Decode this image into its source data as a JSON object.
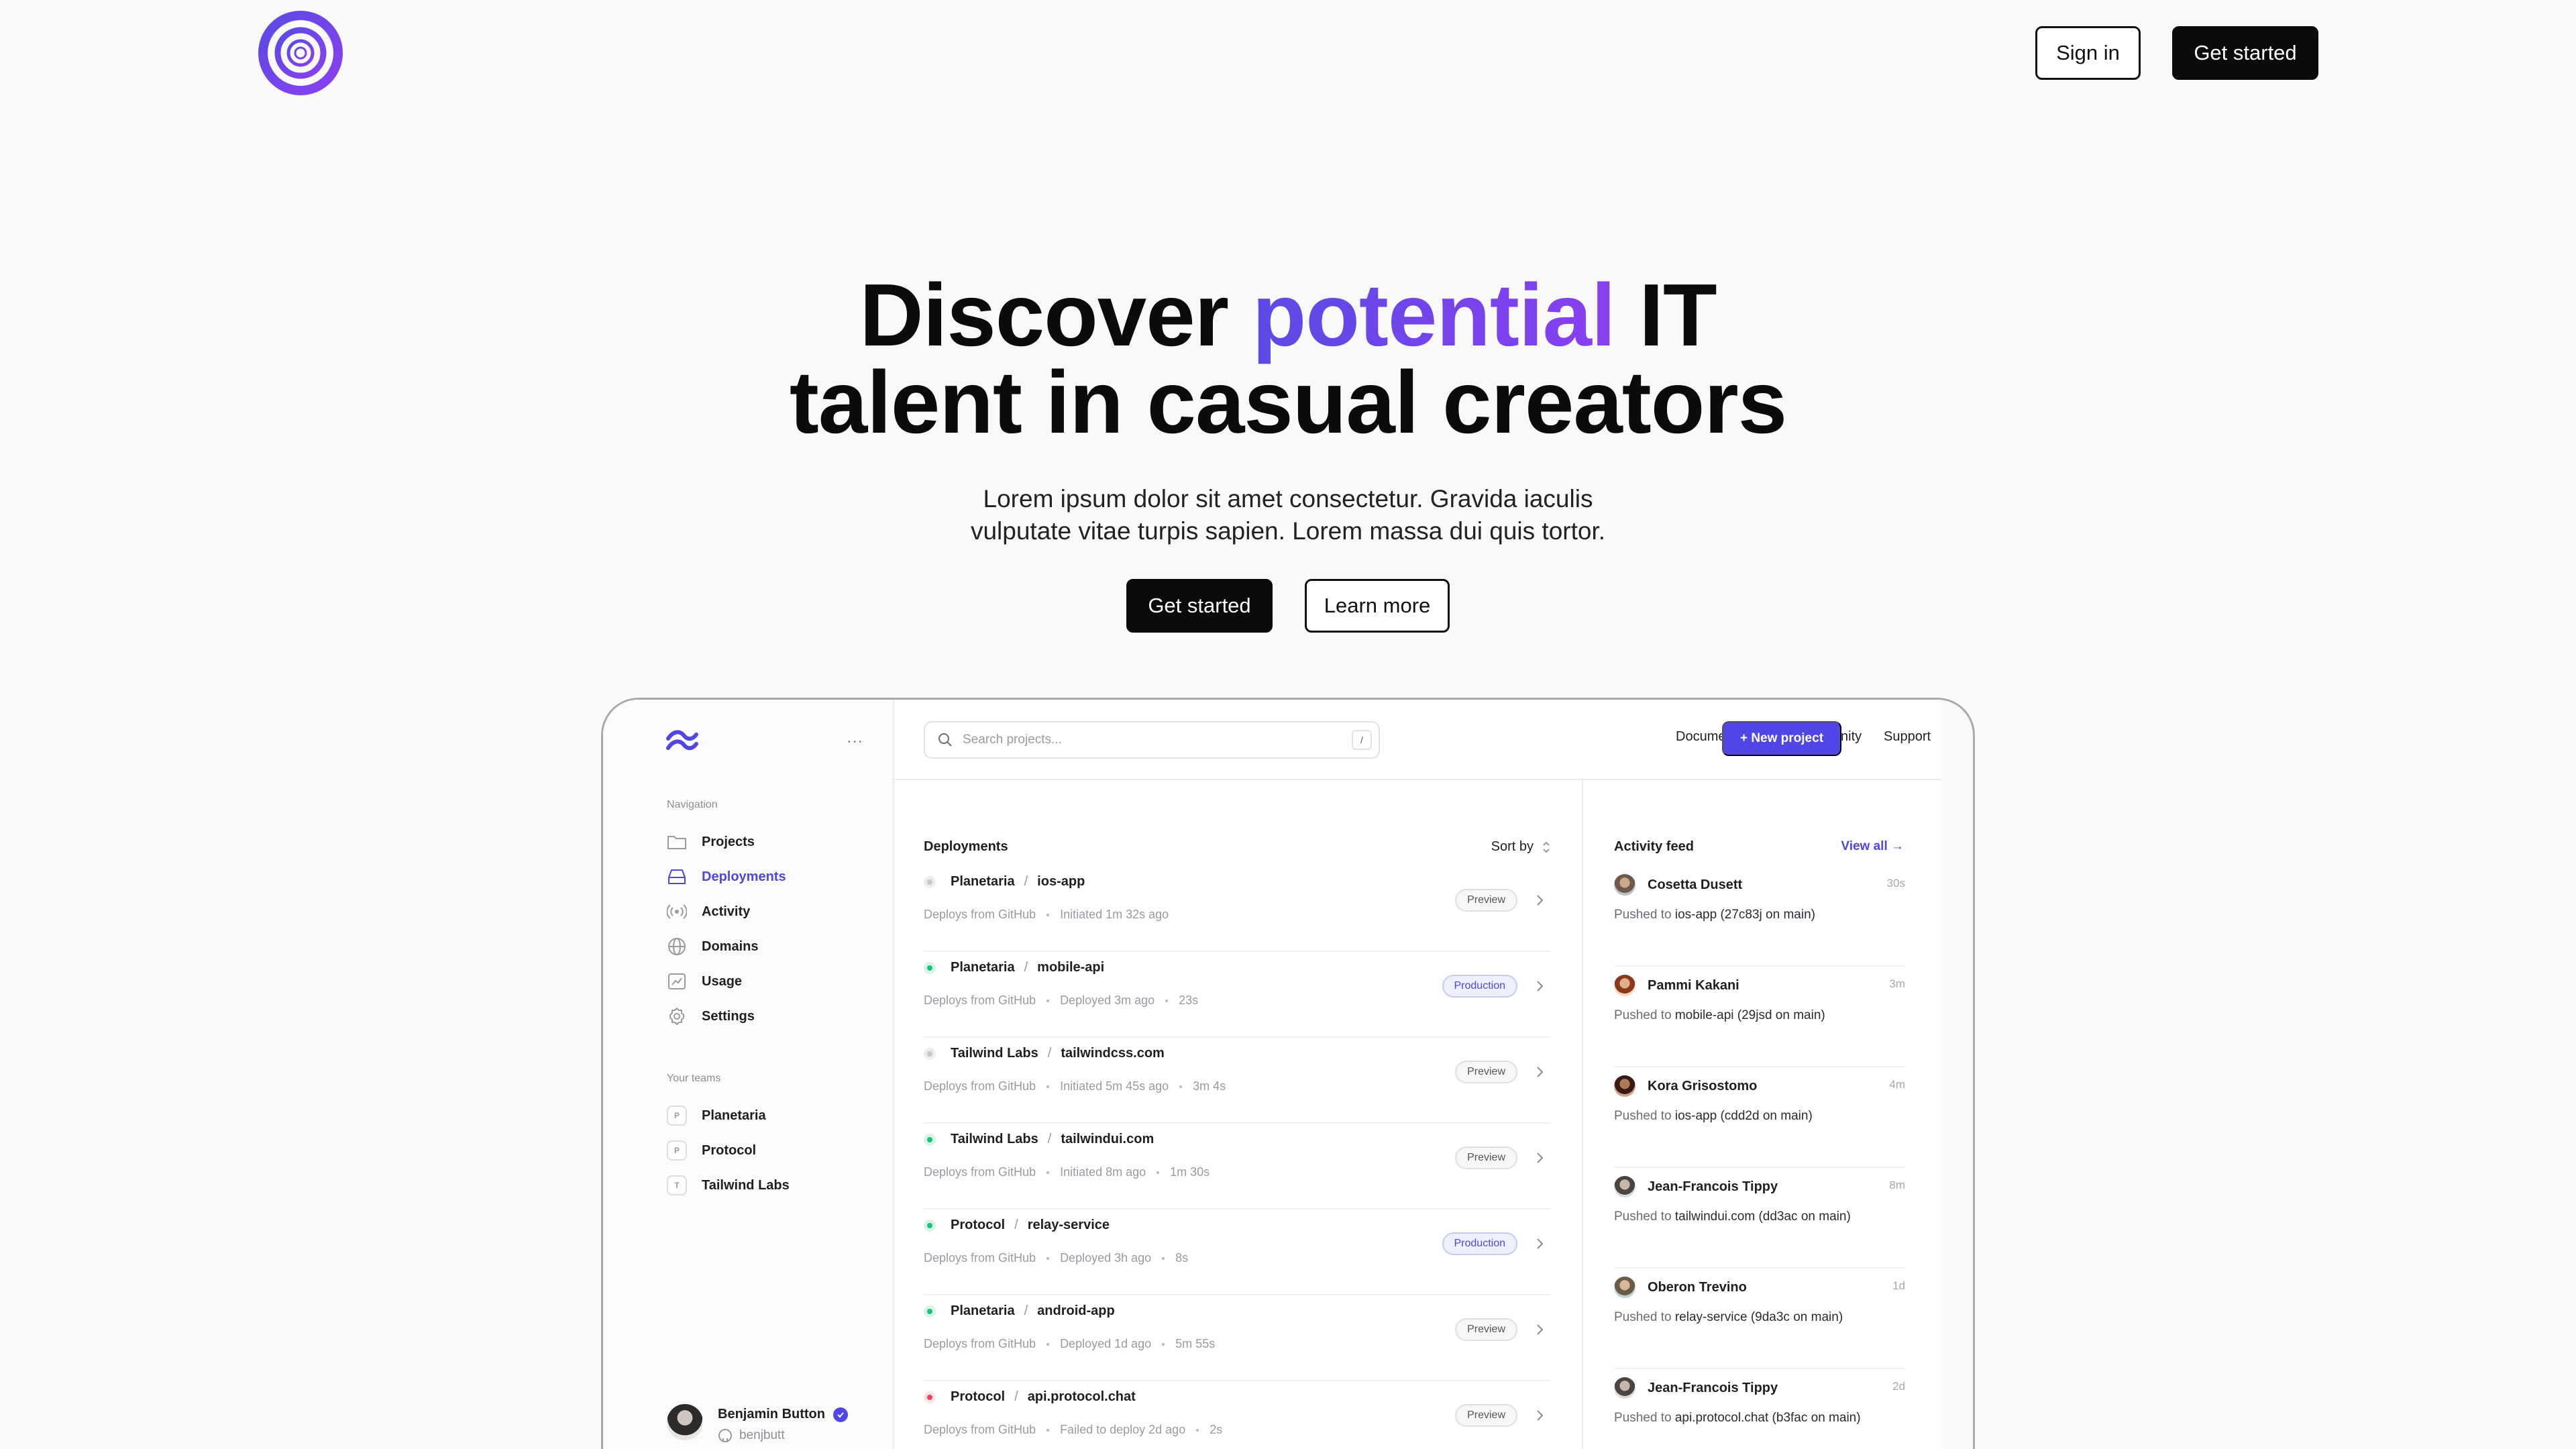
{
  "header": {
    "sign_in_label": "Sign in",
    "get_started_label": "Get started"
  },
  "hero": {
    "title_part1": "Discover ",
    "title_accent": "potential",
    "title_part2": " IT",
    "title_line2": "talent in casual creators",
    "subtitle_line1": "Lorem ipsum dolor sit amet consectetur. Gravida iaculis",
    "subtitle_line2": "vulputate vitae turpis sapien. Lorem massa dui quis tortor.",
    "primary_cta": "Get started",
    "secondary_cta": "Learn more"
  },
  "colors": {
    "accent": "#4f46e5",
    "accent_gradient_end": "#8a3ff0",
    "green": "#16c47a",
    "red": "#f0445a",
    "gray": "#c7c7cc"
  },
  "app": {
    "more_icon": "…",
    "sidebar": {
      "nav_heading": "Navigation",
      "items": [
        {
          "label": "Projects",
          "icon": "folder-icon"
        },
        {
          "label": "Deployments",
          "icon": "server-icon"
        },
        {
          "label": "Activity",
          "icon": "signal-icon"
        },
        {
          "label": "Domains",
          "icon": "globe-icon"
        },
        {
          "label": "Usage",
          "icon": "chart-icon"
        },
        {
          "label": "Settings",
          "icon": "gear-icon"
        }
      ],
      "teams_heading": "Your teams",
      "teams": [
        {
          "initial": "P",
          "label": "Planetaria"
        },
        {
          "initial": "P",
          "label": "Protocol"
        },
        {
          "initial": "T",
          "label": "Tailwind Labs"
        }
      ],
      "user": {
        "name": "Benjamin Button",
        "handle": "benjbutt"
      }
    },
    "topbar": {
      "search_placeholder": "Search projects...",
      "search_shortcut": "/",
      "links": [
        "Documentation",
        "Community",
        "Support"
      ],
      "new_project_label": "+  New project"
    },
    "deployments": {
      "title": "Deployments",
      "sort_label": "Sort by",
      "rows": [
        {
          "org": "Planetaria",
          "project": "ios-app",
          "status": "gray",
          "source": "Deploys from GitHub",
          "time": "Initiated 1m 32s ago",
          "duration": "",
          "env": "Preview"
        },
        {
          "org": "Planetaria",
          "project": "mobile-api",
          "status": "green",
          "source": "Deploys from GitHub",
          "time": "Deployed 3m ago",
          "duration": "23s",
          "env": "Production"
        },
        {
          "org": "Tailwind Labs",
          "project": "tailwindcss.com",
          "status": "gray",
          "source": "Deploys from GitHub",
          "time": "Initiated 5m 45s ago",
          "duration": "3m 4s",
          "env": "Preview"
        },
        {
          "org": "Tailwind Labs",
          "project": "tailwindui.com",
          "status": "green",
          "source": "Deploys from GitHub",
          "time": "Initiated 8m ago",
          "duration": "1m 30s",
          "env": "Preview"
        },
        {
          "org": "Protocol",
          "project": "relay-service",
          "status": "green",
          "source": "Deploys from GitHub",
          "time": "Deployed 3h ago",
          "duration": "8s",
          "env": "Production"
        },
        {
          "org": "Planetaria",
          "project": "android-app",
          "status": "green",
          "source": "Deploys from GitHub",
          "time": "Deployed 1d ago",
          "duration": "5m 55s",
          "env": "Preview"
        },
        {
          "org": "Protocol",
          "project": "api.protocol.chat",
          "status": "red",
          "source": "Deploys from GitHub",
          "time": "Failed to deploy 2d ago",
          "duration": "2s",
          "env": "Preview"
        }
      ]
    },
    "feed": {
      "title": "Activity feed",
      "view_all_label": "View all →",
      "items": [
        {
          "name": "Cosetta Dusett",
          "time": "30s",
          "prefix": "Pushed to ",
          "repo": "ios-app",
          "commit": " (27c83j on ",
          "branch": "main",
          "suffix": ")"
        },
        {
          "name": "Pammi Kakani",
          "time": "3m",
          "prefix": "Pushed to ",
          "repo": "mobile-api",
          "commit": " (29jsd on ",
          "branch": "main",
          "suffix": ")"
        },
        {
          "name": "Kora Grisostomo",
          "time": "4m",
          "prefix": "Pushed to ",
          "repo": "ios-app",
          "commit": " (cdd2d on ",
          "branch": "main",
          "suffix": ")"
        },
        {
          "name": "Jean-Francois Tippy",
          "time": "8m",
          "prefix": "Pushed to ",
          "repo": "tailwindui.com",
          "commit": " (dd3ac on ",
          "branch": "main",
          "suffix": ")"
        },
        {
          "name": "Oberon Trevino",
          "time": "1d",
          "prefix": "Pushed to ",
          "repo": "relay-service",
          "commit": " (9da3c on ",
          "branch": "main",
          "suffix": ")"
        },
        {
          "name": "Jean-Francois Tippy",
          "time": "2d",
          "prefix": "Pushed to ",
          "repo": "api.protocol.chat",
          "commit": " (b3fac on ",
          "branch": "main",
          "suffix": ")"
        }
      ]
    }
  }
}
